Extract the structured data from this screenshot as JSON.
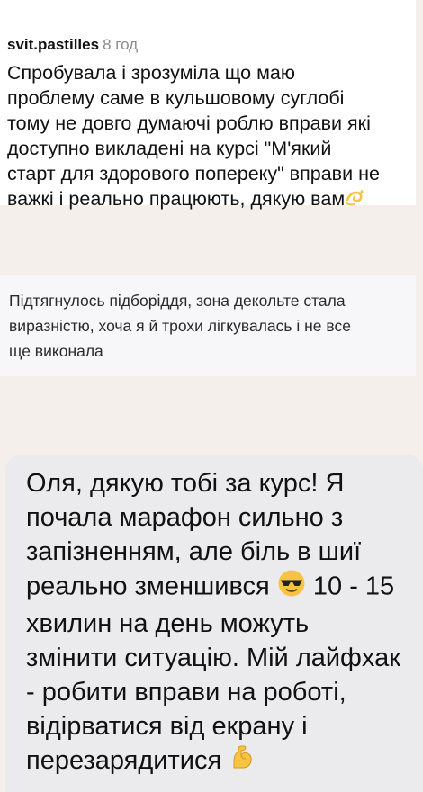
{
  "comment_1": {
    "username": "svit.pastilles",
    "timestamp": "8 год",
    "text": "Спробувала і зрозуміла що маю\nпроблему саме в кульшовому суглобі\nтому не довго думаючі роблю вправи  які\nдоступно викладені на курсі \"М'який\nстарт для здорового попереку\" вправи не\nважкі і реально працюють, дякую вам",
    "emoji": "dizzy-emoji"
  },
  "comment_2": {
    "text": "Підтягнулось підборіддя, зона декольте стала\nвиразністю, хоча я й трохи лігкувалась і не все\nще виконала"
  },
  "comment_3": {
    "lines": [
      "Оля, дякую тобі за курс! Я",
      "почала марафон сильно з",
      "запізненням, але біль в шиї",
      "реально зменшився",
      "10 - 15",
      "хвилин на день можуть",
      "змінити ситуацію. Мій лайфхак",
      "- робити вправи на роботі,",
      "відірватися від екрану і",
      "перезарядитися"
    ],
    "emoji_1": "sunglasses-emoji",
    "emoji_2": "flexed-biceps-emoji"
  },
  "colors": {
    "background": "#f5efec",
    "card": "#ffffff",
    "card_light": "#f7f7f9",
    "bubble": "#ebebed",
    "timestamp": "#8a8a8a",
    "emoji_yellow": "#f6c343"
  }
}
